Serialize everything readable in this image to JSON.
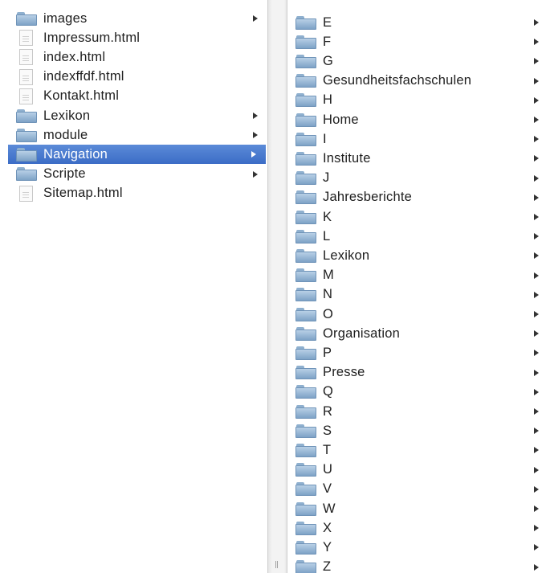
{
  "left_column": {
    "items": [
      {
        "type": "folder",
        "label": "images",
        "has_children": true
      },
      {
        "type": "file",
        "label": "Impressum.html",
        "has_children": false
      },
      {
        "type": "file",
        "label": "index.html",
        "has_children": false
      },
      {
        "type": "file",
        "label": "indexffdf.html",
        "has_children": false
      },
      {
        "type": "file",
        "label": "Kontakt.html",
        "has_children": false
      },
      {
        "type": "folder",
        "label": "Lexikon",
        "has_children": true
      },
      {
        "type": "folder",
        "label": "module",
        "has_children": true
      },
      {
        "type": "folder",
        "label": "Navigation",
        "has_children": true,
        "selected": true
      },
      {
        "type": "folder",
        "label": "Scripte",
        "has_children": true
      },
      {
        "type": "file",
        "label": "Sitemap.html",
        "has_children": false
      }
    ]
  },
  "right_column": {
    "items": [
      {
        "type": "folder",
        "label": "E",
        "has_children": true
      },
      {
        "type": "folder",
        "label": "F",
        "has_children": true
      },
      {
        "type": "folder",
        "label": "G",
        "has_children": true
      },
      {
        "type": "folder",
        "label": "Gesundheitsfachschulen",
        "has_children": true
      },
      {
        "type": "folder",
        "label": "H",
        "has_children": true
      },
      {
        "type": "folder",
        "label": "Home",
        "has_children": true
      },
      {
        "type": "folder",
        "label": "I",
        "has_children": true
      },
      {
        "type": "folder",
        "label": "Institute",
        "has_children": true
      },
      {
        "type": "folder",
        "label": "J",
        "has_children": true
      },
      {
        "type": "folder",
        "label": "Jahresberichte",
        "has_children": true
      },
      {
        "type": "folder",
        "label": "K",
        "has_children": true
      },
      {
        "type": "folder",
        "label": "L",
        "has_children": true
      },
      {
        "type": "folder",
        "label": "Lexikon",
        "has_children": true
      },
      {
        "type": "folder",
        "label": "M",
        "has_children": true
      },
      {
        "type": "folder",
        "label": "N",
        "has_children": true
      },
      {
        "type": "folder",
        "label": "O",
        "has_children": true
      },
      {
        "type": "folder",
        "label": "Organisation",
        "has_children": true
      },
      {
        "type": "folder",
        "label": "P",
        "has_children": true
      },
      {
        "type": "folder",
        "label": "Presse",
        "has_children": true
      },
      {
        "type": "folder",
        "label": "Q",
        "has_children": true
      },
      {
        "type": "folder",
        "label": "R",
        "has_children": true
      },
      {
        "type": "folder",
        "label": "S",
        "has_children": true
      },
      {
        "type": "folder",
        "label": "T",
        "has_children": true
      },
      {
        "type": "folder",
        "label": "U",
        "has_children": true
      },
      {
        "type": "folder",
        "label": "V",
        "has_children": true
      },
      {
        "type": "folder",
        "label": "W",
        "has_children": true
      },
      {
        "type": "folder",
        "label": "X",
        "has_children": true
      },
      {
        "type": "folder",
        "label": "Y",
        "has_children": true
      },
      {
        "type": "folder",
        "label": "Z",
        "has_children": true
      }
    ]
  },
  "colors": {
    "selection": "#3b6cc6",
    "folder": "#8fb0cf",
    "text": "#202020"
  }
}
